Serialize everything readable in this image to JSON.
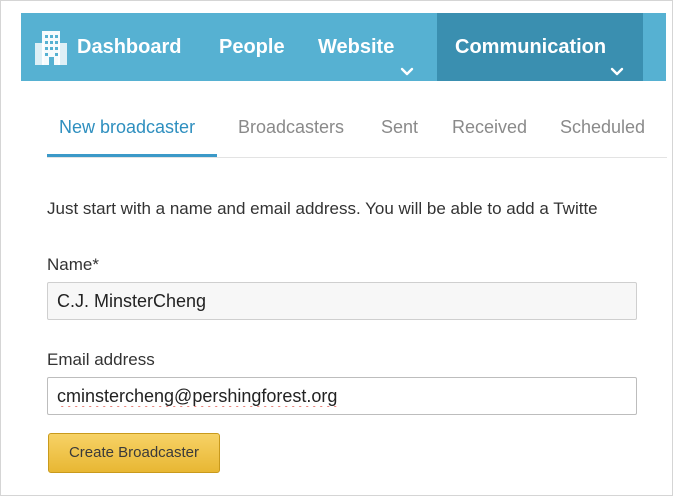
{
  "nav": {
    "dashboard": "Dashboard",
    "people": "People",
    "website": "Website",
    "communication": "Communication"
  },
  "tabs": [
    {
      "label": "New broadcaster",
      "active": true
    },
    {
      "label": "Broadcasters",
      "active": false
    },
    {
      "label": "Sent",
      "active": false
    },
    {
      "label": "Received",
      "active": false
    },
    {
      "label": "Scheduled",
      "active": false
    }
  ],
  "intro": "Just start with a name and email address. You will be able to add a Twitte",
  "form": {
    "name_label": "Name*",
    "name_value": "C.J. MinsterCheng",
    "email_label": "Email address",
    "email_value": "cminstercheng@pershingforest.org",
    "submit_label": "Create Broadcaster"
  },
  "colors": {
    "nav_bg": "#56b1d2",
    "nav_active_bg": "#3a8fb0",
    "tab_active": "#2e8fbf",
    "button_bg": "#f0c64b"
  }
}
